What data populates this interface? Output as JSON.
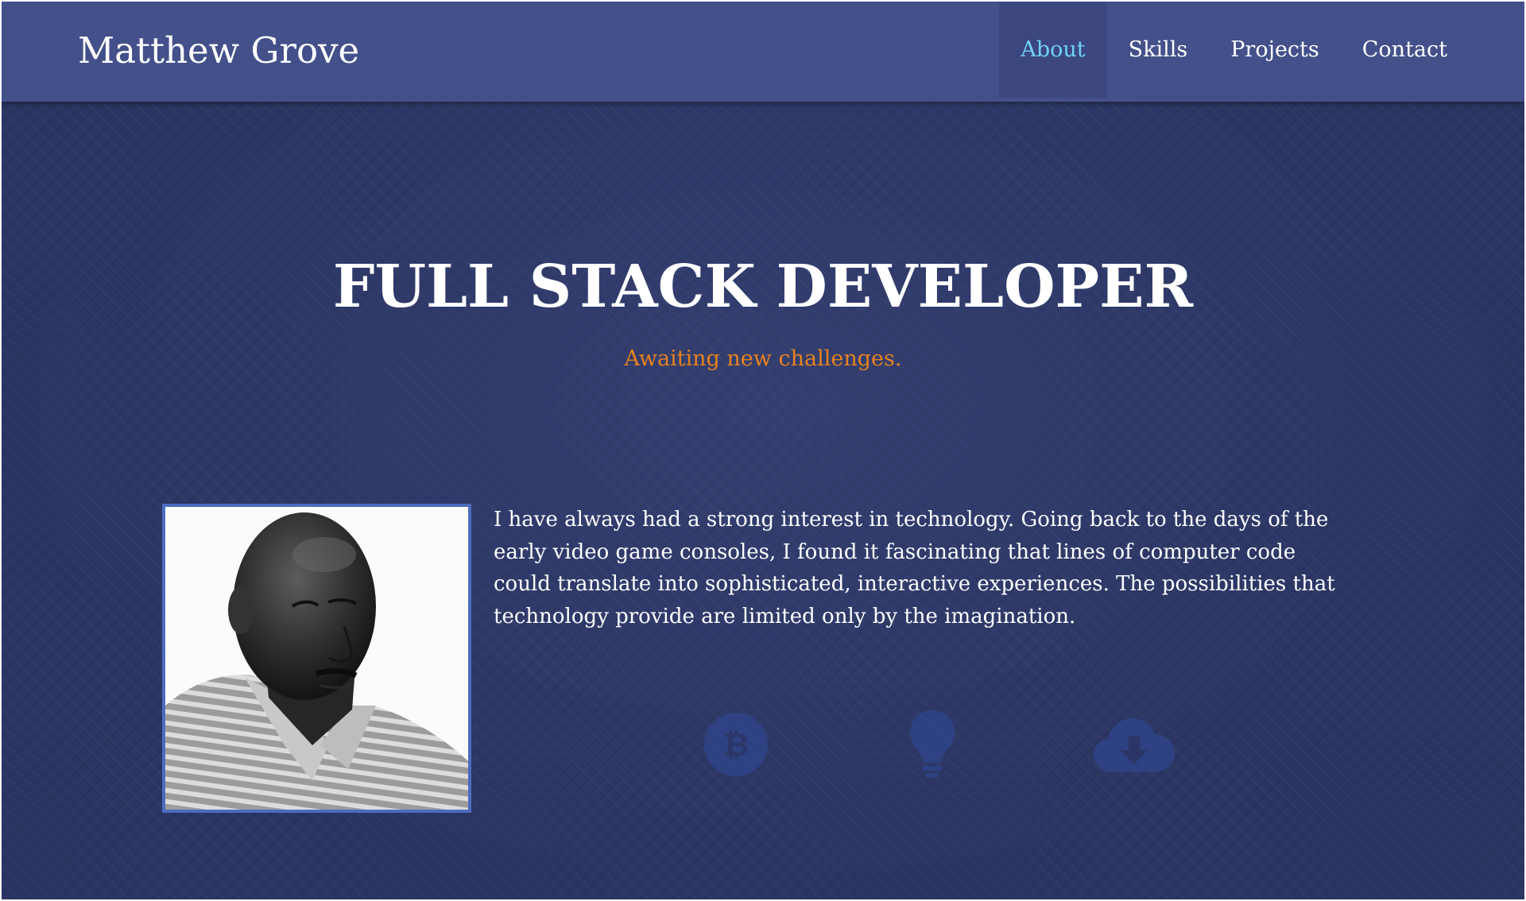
{
  "header": {
    "brand": "Matthew Grove",
    "nav": [
      {
        "label": "About",
        "active": true
      },
      {
        "label": "Skills",
        "active": false
      },
      {
        "label": "Projects",
        "active": false
      },
      {
        "label": "Contact",
        "active": false
      }
    ]
  },
  "hero": {
    "title": "FULL STACK DEVELOPER",
    "subtitle": "Awaiting new challenges."
  },
  "about": {
    "text": "I have always had a strong interest in technology. Going back to the days of the early video game consoles, I found it fascinating that lines of computer code could translate into sophisticated, interactive experiences. The possibilities that technology provide are limited only by the imagination.",
    "photo_alt": "Matthew Grove portrait"
  },
  "background_icons": [
    "bitcoin-icon",
    "lightbulb-icon",
    "cloud-download-icon"
  ],
  "colors": {
    "page_background": "#2b3562",
    "navbar": "#43508a",
    "nav_active_background": "#3c4780",
    "nav_active_text": "#6fd3f4",
    "subtitle": "#e8821c",
    "portrait_border": "#4b6cc0",
    "faint_icons": "#2f4b9a"
  }
}
